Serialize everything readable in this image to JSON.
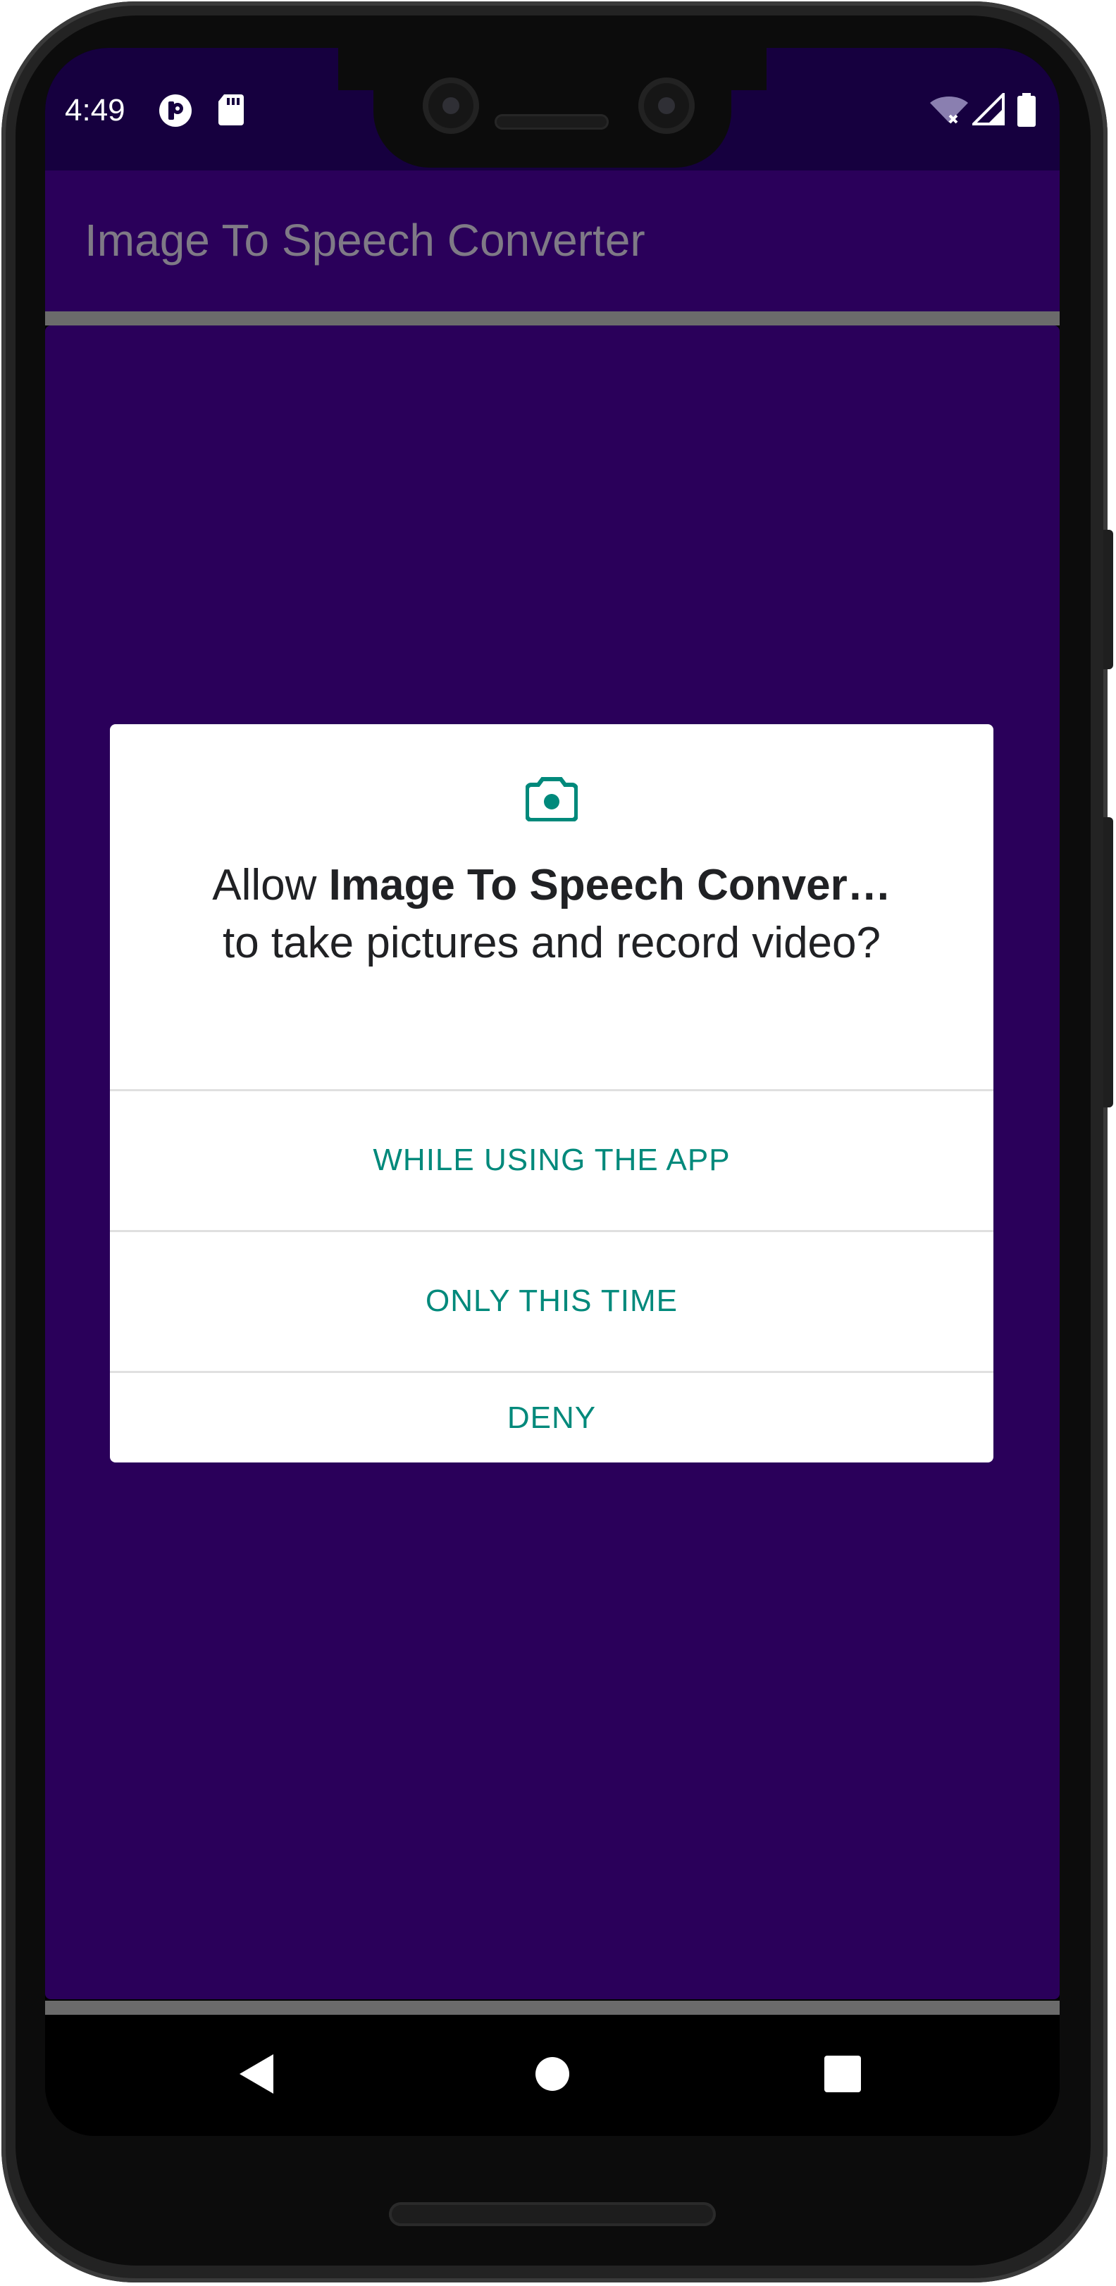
{
  "status_bar": {
    "time": "4:49",
    "left_icons": [
      "p-app-icon",
      "sd-card-icon"
    ],
    "right_icons": [
      "wifi-off-icon",
      "signal-icon",
      "battery-icon"
    ]
  },
  "app_bar": {
    "title": "Image To Speech Converter"
  },
  "dialog": {
    "icon": "camera-icon",
    "message_prefix": "Allow ",
    "app_name": "Image To Speech Conver…",
    "message_suffix": "to take pictures and record video?",
    "buttons": [
      {
        "label": "WHILE USING THE APP"
      },
      {
        "label": "ONLY THIS TIME"
      },
      {
        "label": "DENY"
      }
    ]
  },
  "nav_bar": {
    "items": [
      "back-icon",
      "home-icon",
      "recents-icon"
    ]
  },
  "colors": {
    "status_bar": "#16003f",
    "app_bar": "#2a005a",
    "content": "#2a005a",
    "accent": "#00897b",
    "dialog_bg": "#ffffff"
  }
}
